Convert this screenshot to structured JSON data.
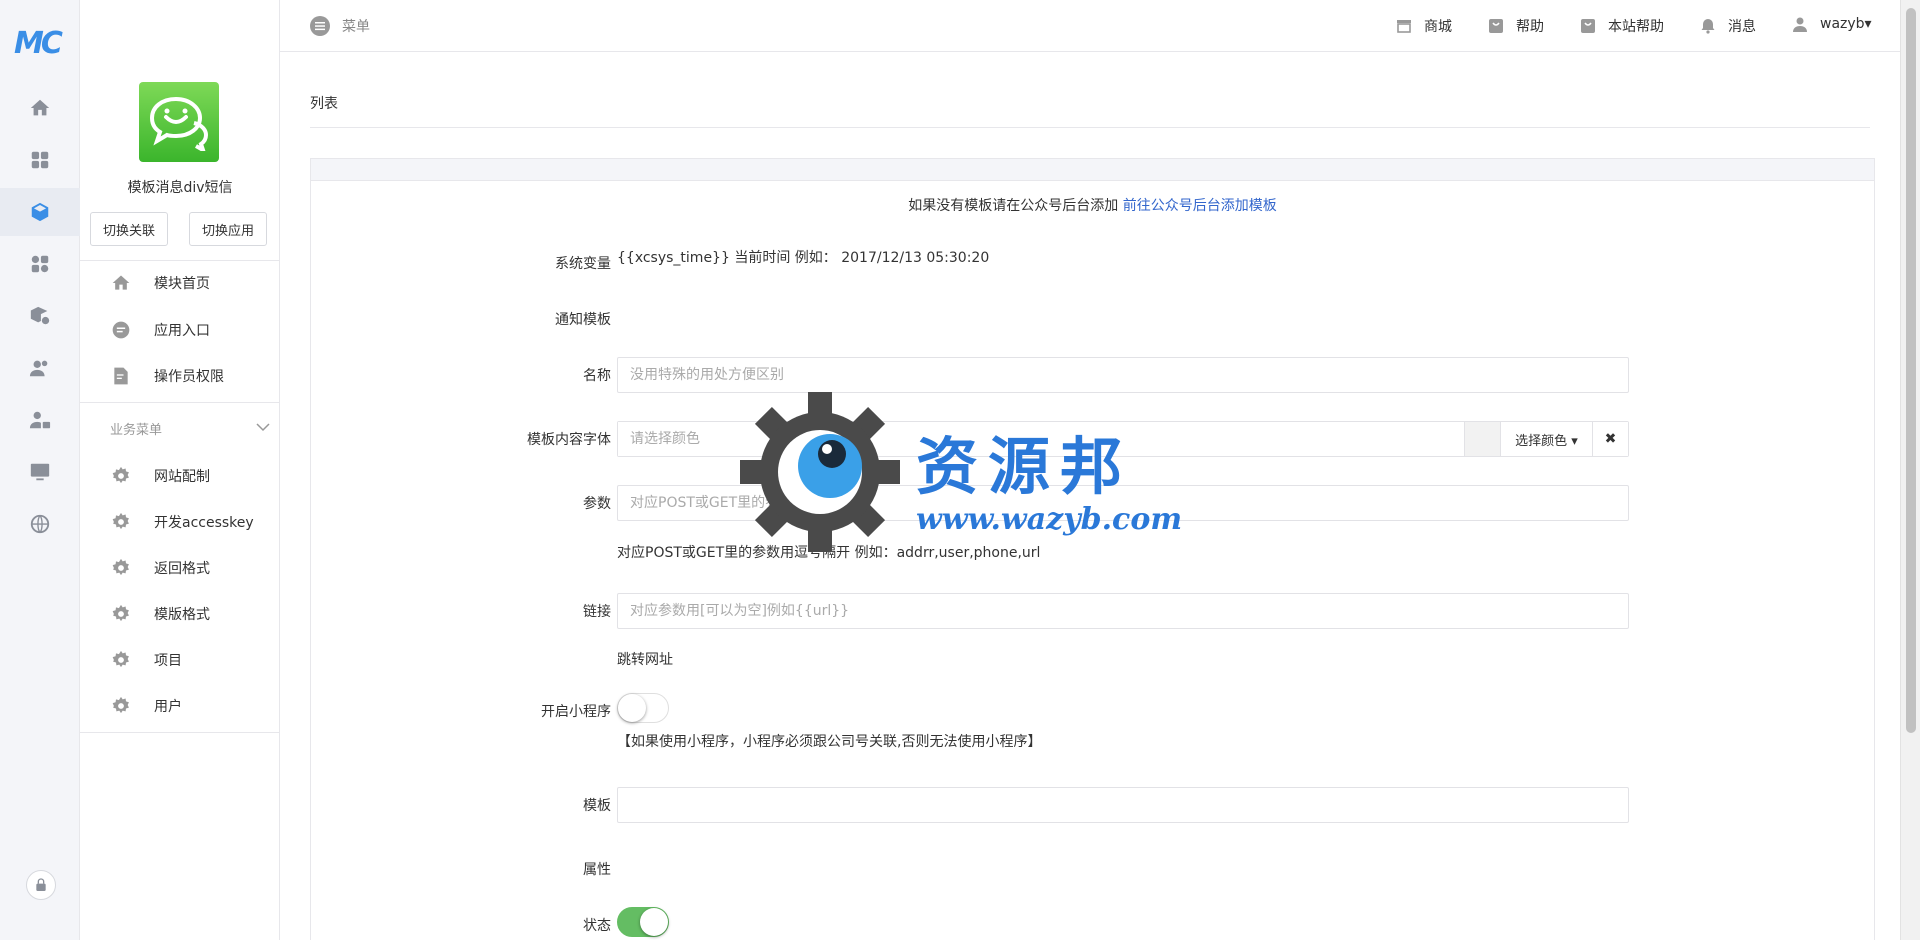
{
  "rail": {
    "logo": "MC",
    "icons": [
      "home-icon",
      "grid-icon",
      "cube-icon",
      "apps-icon",
      "box-gear-icon",
      "users-icon",
      "user-lock-icon",
      "monitor-icon",
      "globe-icon"
    ],
    "active": "cube-icon",
    "bottom_icon": "lock-icon"
  },
  "sidebar": {
    "app_name": "模板消息div短信",
    "switch_link_label": "切换关联",
    "switch_app_label": "切换应用",
    "items": [
      {
        "label": "模块首页",
        "icon": "home-icon"
      },
      {
        "label": "应用入口",
        "icon": "chat-icon"
      },
      {
        "label": "操作员权限",
        "icon": "doc-edit-icon"
      }
    ],
    "group_label": "业务菜单",
    "group_items": [
      {
        "label": "网站配制",
        "icon": "gear-icon"
      },
      {
        "label": "开发accesskey",
        "icon": "gear-icon"
      },
      {
        "label": "返回格式",
        "icon": "gear-icon"
      },
      {
        "label": "模版格式",
        "icon": "gear-icon"
      },
      {
        "label": "项目",
        "icon": "gear-icon"
      },
      {
        "label": "用户",
        "icon": "gear-icon"
      }
    ]
  },
  "topbar": {
    "menu_label": "菜单",
    "nav": [
      {
        "label": "商城",
        "icon": "shop-icon"
      },
      {
        "label": "帮助",
        "icon": "bag-icon"
      },
      {
        "label": "本站帮助",
        "icon": "bag-icon"
      },
      {
        "label": "消息",
        "icon": "bell-icon"
      },
      {
        "label": "wazyb▾",
        "icon": "user-icon"
      }
    ]
  },
  "main": {
    "breadcrumb": "列表",
    "notice_text": "如果没有模板请在公众号后台添加",
    "notice_link": "前往公众号后台添加模板",
    "fields": {
      "sysvar_label": "系统变量",
      "sysvar_value": "{{xcsys_time}} 当前时间 例如： 2017/12/13 05:30:20",
      "notify_label": "通知模板",
      "name_label": "名称",
      "name_placeholder": "没用特殊的用处方便区别",
      "font_label": "模板内容字体",
      "font_placeholder": "请选择颜色",
      "pick_color_label": "选择颜色 ▾",
      "clear_label": "✖",
      "param_label": "参数",
      "param_placeholder": "对应POST或GET里的参数用逗号隔开",
      "param_help": "对应POST或GET里的参数用逗号隔开 例如：addrr,user,phone,url",
      "link_label": "链接",
      "link_placeholder": "对应参数用[可以为空]例如{{url}}",
      "link_help": "跳转网址",
      "miniapp_label": "开启小程序",
      "miniapp_on": false,
      "miniapp_help": "【如果使用小程序，小程序必须跟公司号关联,否则无法使用小程序】",
      "template_label": "模板",
      "template_value": "",
      "attr_label": "属性",
      "status_label": "状态",
      "status_on": true
    }
  },
  "watermark": {
    "text": "资源邦",
    "url": "www.wazyb.com"
  },
  "colors": {
    "accent": "#3a8ee6",
    "link": "#3366cc",
    "switch_on": "#64bd63",
    "watermark": "#2a78d8"
  }
}
